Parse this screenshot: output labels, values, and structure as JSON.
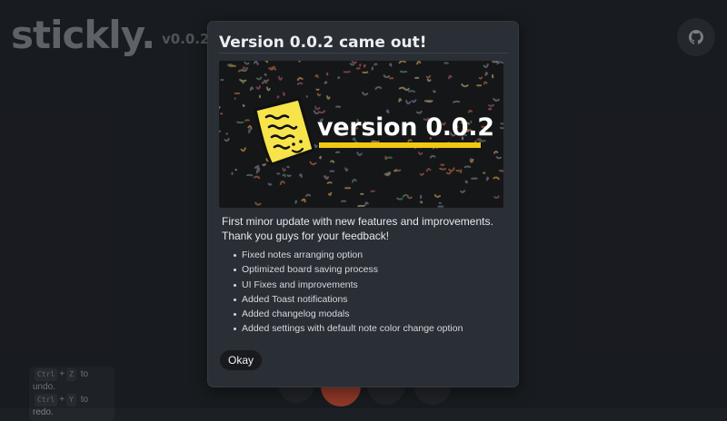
{
  "app": {
    "brand": "stickly.",
    "version": "v0.0.2",
    "github_icon": "github-icon",
    "shortcuts": [
      {
        "modifier": "Ctrl",
        "plus": "+",
        "key": "Z",
        "action": "to undo."
      },
      {
        "modifier": "Ctrl",
        "plus": "+",
        "key": "Y",
        "action": "to redo."
      }
    ],
    "toolbar_accent": "#a3402e"
  },
  "modal": {
    "title": "Version 0.0.2 came out!",
    "banner": {
      "text": "version 0.0.2",
      "icon": "sticky-note-icon",
      "note_color": "#f7e44b",
      "underline_color": "#f2c811"
    },
    "intro_lines": [
      "First minor update with new features and improvements.",
      "Thank you guys for your feedback!"
    ],
    "changes": [
      "Fixed notes arranging option",
      "Optimized board saving process",
      "UI Fixes and improvements",
      "Added Toast notifications",
      "Added changelog modals",
      "Added settings with default note color change option"
    ],
    "okay_label": "Okay"
  }
}
